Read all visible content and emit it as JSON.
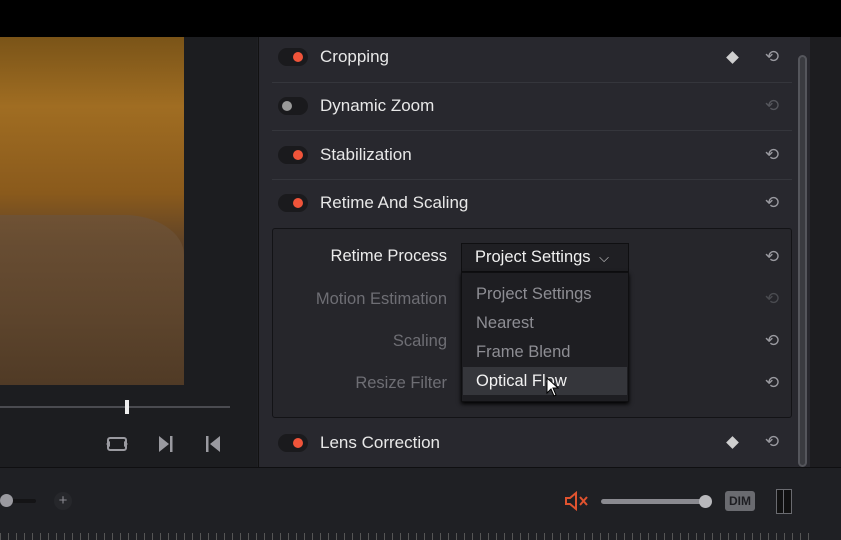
{
  "viewer": {
    "controls": [
      {
        "name": "loop-icon",
        "glyph": "⟲"
      },
      {
        "name": "next-frame-icon",
        "glyph": "▶|"
      },
      {
        "name": "previous-frame-icon",
        "glyph": "|◀"
      }
    ]
  },
  "inspector": {
    "sections": [
      {
        "label": "Cropping",
        "enabled": true,
        "keyframe": true
      },
      {
        "label": "Dynamic Zoom",
        "enabled": false,
        "keyframe": false
      },
      {
        "label": "Stabilization",
        "enabled": true,
        "keyframe": false
      },
      {
        "label": "Retime And Scaling",
        "enabled": true,
        "keyframe": false
      },
      {
        "label": "Lens Correction",
        "enabled": true,
        "keyframe": true
      }
    ],
    "retime": {
      "rows": [
        {
          "label": "Retime Process",
          "enabled": true
        },
        {
          "label": "Motion Estimation",
          "enabled": false
        },
        {
          "label": "Scaling",
          "enabled": false
        },
        {
          "label": "Resize Filter",
          "enabled": false
        }
      ],
      "dropdown": {
        "value": "Project Settings",
        "options": [
          "Project Settings",
          "Nearest",
          "Frame Blend",
          "Optical Flow"
        ],
        "highlighted": "Optical Flow"
      }
    }
  },
  "bottom": {
    "zoom_plus": "+",
    "mute_icon": "speaker-muted",
    "volume_level": 1.0,
    "dim_label": "DIM"
  },
  "colors": {
    "accent": "#f0543a",
    "panel": "#28282e",
    "mute": "#e0532f"
  }
}
